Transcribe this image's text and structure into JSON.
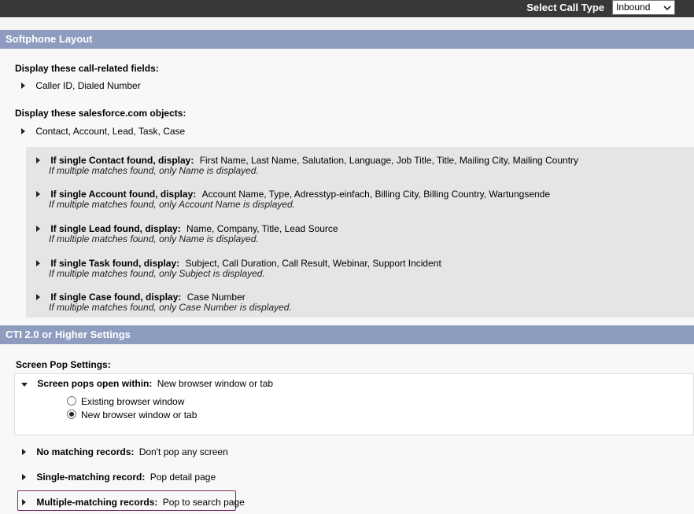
{
  "header": {
    "call_type_label": "Select Call Type",
    "call_type_value": "Inbound"
  },
  "softphone": {
    "title": "Softphone Layout",
    "call_fields_heading": "Display these call-related fields:",
    "call_fields_value": "Caller ID, Dialed Number",
    "objects_heading": "Display these salesforce.com objects:",
    "objects_value": "Contact, Account, Lead, Task, Case",
    "items": [
      {
        "label": "If single Contact found, display:",
        "value": "First Name, Last Name, Salutation, Language, Job Title, Title, Mailing City, Mailing Country",
        "note": "If multiple matches found, only Name is displayed."
      },
      {
        "label": "If single Account found, display:",
        "value": "Account Name, Type, Adresstyp-einfach, Billing City, Billing Country, Wartungsende",
        "note": "If multiple matches found, only Account Name is displayed."
      },
      {
        "label": "If single Lead found, display:",
        "value": "Name, Company, Title, Lead Source",
        "note": "If multiple matches found, only Name is displayed."
      },
      {
        "label": "If single Task found, display:",
        "value": "Subject, Call Duration, Call Result, Webinar, Support Incident",
        "note": "If multiple matches found, only Subject is displayed."
      },
      {
        "label": "If single Case found, display:",
        "value": "Case Number",
        "note": "If multiple matches found, only Case Number is displayed."
      }
    ]
  },
  "cti": {
    "title": "CTI 2.0 or Higher Settings",
    "screen_pop_heading": "Screen Pop Settings:",
    "open_within_label": "Screen pops open within:",
    "open_within_value": "New browser window or tab",
    "options": [
      "Existing browser window",
      "New browser window or tab"
    ],
    "selected_option": "New browser window or tab",
    "rules": [
      {
        "label": "No matching records:",
        "value": "Don't pop any screen"
      },
      {
        "label": "Single-matching record:",
        "value": "Pop detail page"
      },
      {
        "label": "Multiple-matching records:",
        "value": "Pop to search page"
      }
    ]
  },
  "colors": {
    "section_bar": "#8e9dbf",
    "top_bar": "#383838",
    "highlight_border": "#7a2a63"
  }
}
